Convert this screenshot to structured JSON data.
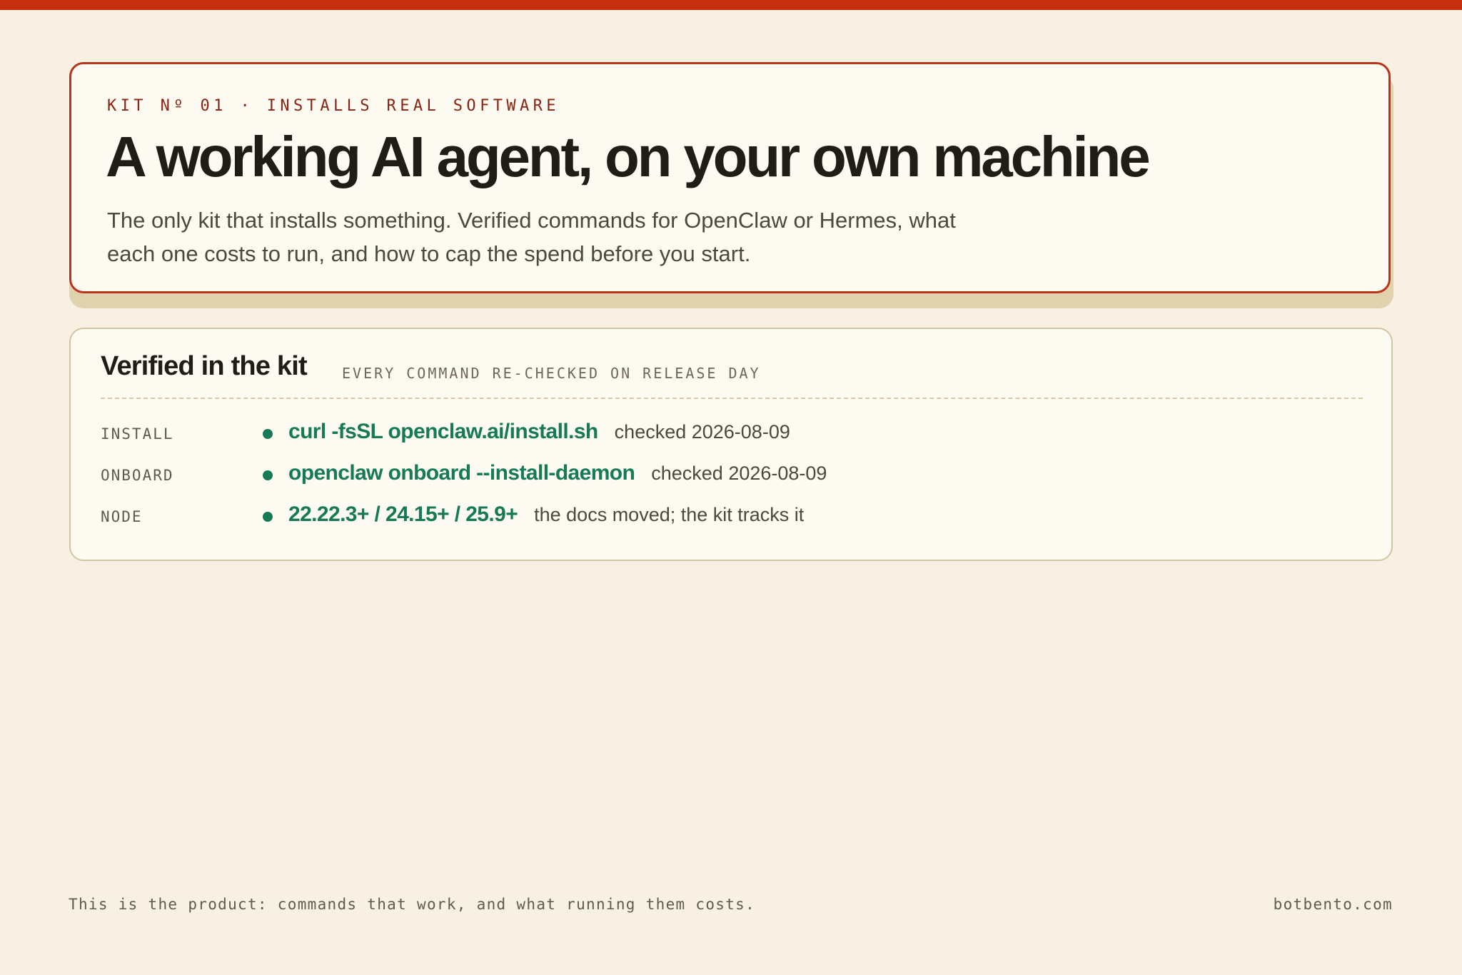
{
  "colors": {
    "accent": "#c4300d",
    "hero_border": "#b8341a",
    "command_green": "#157a55",
    "background": "#f8f1e3",
    "card": "#fdfaf1"
  },
  "hero": {
    "kicker": "KIT Nº 01 · INSTALLS REAL SOFTWARE",
    "headline": "A working AI agent, on your own machine",
    "lede": "The only kit that installs something. Verified commands for OpenClaw or Hermes, what each one costs to run, and how to cap the spend before you start."
  },
  "verified": {
    "title": "Verified in the kit",
    "subtitle": "EVERY COMMAND RE-CHECKED ON RELEASE DAY",
    "rows": [
      {
        "label": "INSTALL",
        "value": "curl -fsSL openclaw.ai/install.sh",
        "note": "checked 2026-08-09"
      },
      {
        "label": "ONBOARD",
        "value": "openclaw onboard --install-daemon",
        "note": "checked 2026-08-09"
      },
      {
        "label": "NODE",
        "value": "22.22.3+ / 24.15+ / 25.9+",
        "note": "the docs moved; the kit tracks it"
      }
    ]
  },
  "footer": {
    "tagline": "This is the product: commands that work, and what running them costs.",
    "domain": "botbento.com"
  }
}
